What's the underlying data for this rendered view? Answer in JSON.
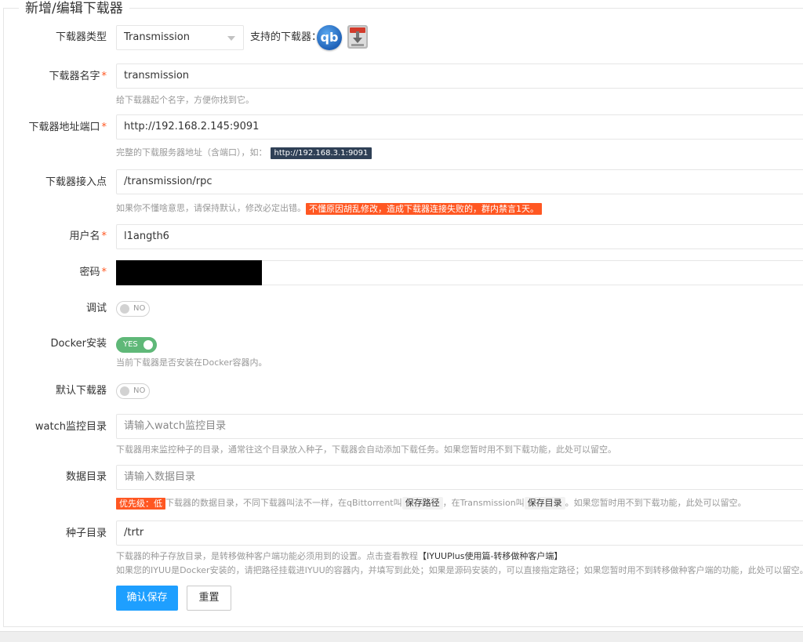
{
  "legend": "新增/编辑下载器",
  "type_field": {
    "label": "下载器类型",
    "value": "Transmission",
    "supported_label": "支持的下载器：",
    "qb_icon_text": "qb"
  },
  "name_field": {
    "label": "下载器名字",
    "required": "*",
    "value": "transmission",
    "aux": "给下载器起个名字，方便你找到它。"
  },
  "address_field": {
    "label": "下载器地址端口",
    "required": "*",
    "value": "http://192.168.2.145:9091",
    "aux_prefix": "完整的下载服务器地址（含端口），如：",
    "aux_code": "http://192.168.3.1:9091"
  },
  "endpoint_field": {
    "label": "下载器接入点",
    "value": "/transmission/rpc",
    "aux_prefix": "如果你不懂啥意思，请保持默认，修改必定出错。",
    "aux_warn": "不懂原因胡乱修改，造成下载器连接失败的，群内禁言1天。"
  },
  "username_field": {
    "label": "用户名",
    "required": "*",
    "value": "l1angth6"
  },
  "password_field": {
    "label": "密码",
    "required": "*"
  },
  "debug_field": {
    "label": "调试",
    "state": "NO"
  },
  "docker_field": {
    "label": "Docker安装",
    "state": "YES",
    "aux": "当前下载器是否安装在Docker容器内。"
  },
  "default_field": {
    "label": "默认下载器",
    "state": "NO"
  },
  "watch_field": {
    "label": "watch监控目录",
    "placeholder": "请输入watch监控目录",
    "aux": "下载器用来监控种子的目录，通常往这个目录放入种子，下载器会自动添加下载任务。如果您暂时用不到下载功能，此处可以留空。"
  },
  "data_field": {
    "label": "数据目录",
    "placeholder": "请输入数据目录",
    "aux_warn": "优先级：低",
    "aux_text1": "下载器的数据目录，不同下载器叫法不一样，在qBittorrent叫",
    "aux_kbd1": "保存路径",
    "aux_text2": "，在Transmission叫",
    "aux_kbd2": "保存目录",
    "aux_text3": "。如果您暂时用不到下载功能，此处可以留空。"
  },
  "seed_field": {
    "label": "种子目录",
    "value": "/trtr",
    "aux_line1_prefix": "下载器的种子存放目录，是转移做种客户端功能必须用到的设置。点击查看教程",
    "aux_line1_link": "【IYUUPlus使用篇-转移做种客户端】",
    "aux_line2": "如果您的IYUU是Docker安装的，请把路径挂载进IYUU的容器内，并填写到此处；如果是源码安装的，可以直接指定路径；如果您暂时用不到转移做种客户端的功能，此处可以留空。"
  },
  "buttons": {
    "save": "确认保存",
    "reset": "重置"
  },
  "colors": {
    "primary": "#1e9fff",
    "success": "#5fb878",
    "warn": "#ff5722",
    "code_bg": "#2f4056"
  }
}
